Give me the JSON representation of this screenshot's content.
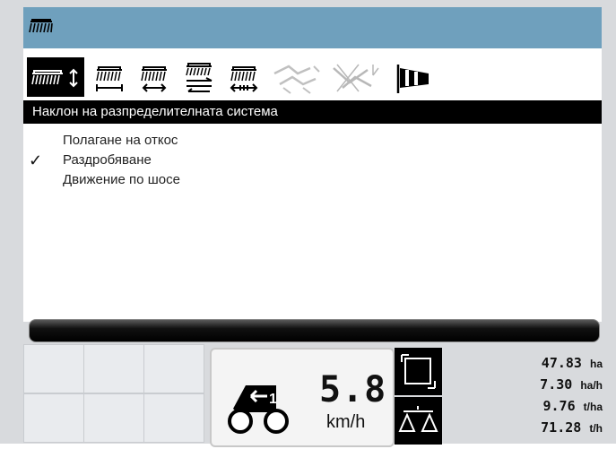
{
  "titlebar": {
    "icon": "harrow-icon"
  },
  "toolbar": {
    "tools": [
      {
        "name": "harrow-tilt-icon",
        "active": true
      },
      {
        "name": "harrow-width-icon",
        "active": false
      },
      {
        "name": "harrow-shift-icon",
        "active": false
      },
      {
        "name": "harrow-fold-icon",
        "active": false
      },
      {
        "name": "harrow-spread-icon",
        "active": false
      },
      {
        "name": "implement-disabled-icon",
        "active": false
      },
      {
        "name": "implement-crossed-icon",
        "active": false
      },
      {
        "name": "windsock-icon",
        "active": false
      }
    ]
  },
  "section": {
    "title": "Наклон на разпределителната система"
  },
  "options": [
    {
      "label": "Полагане на откос",
      "checked": false
    },
    {
      "label": "Раздробяване",
      "checked": true
    },
    {
      "label": "Движение по шосе",
      "checked": false
    }
  ],
  "check_mark": "✓",
  "status": {
    "gear": "1",
    "speed": "5.8",
    "speed_unit": "km/h",
    "area_value": "47.83",
    "area_unit": "ha",
    "area_rate": "7.30",
    "area_rate_unit": "ha/h",
    "yield": "9.76",
    "yield_unit": "t/ha",
    "throughput": "71.28",
    "throughput_unit": "t/h"
  },
  "colors": {
    "titlebar": "#6fa0bd",
    "header": "#000000",
    "background": "#ffffff"
  }
}
